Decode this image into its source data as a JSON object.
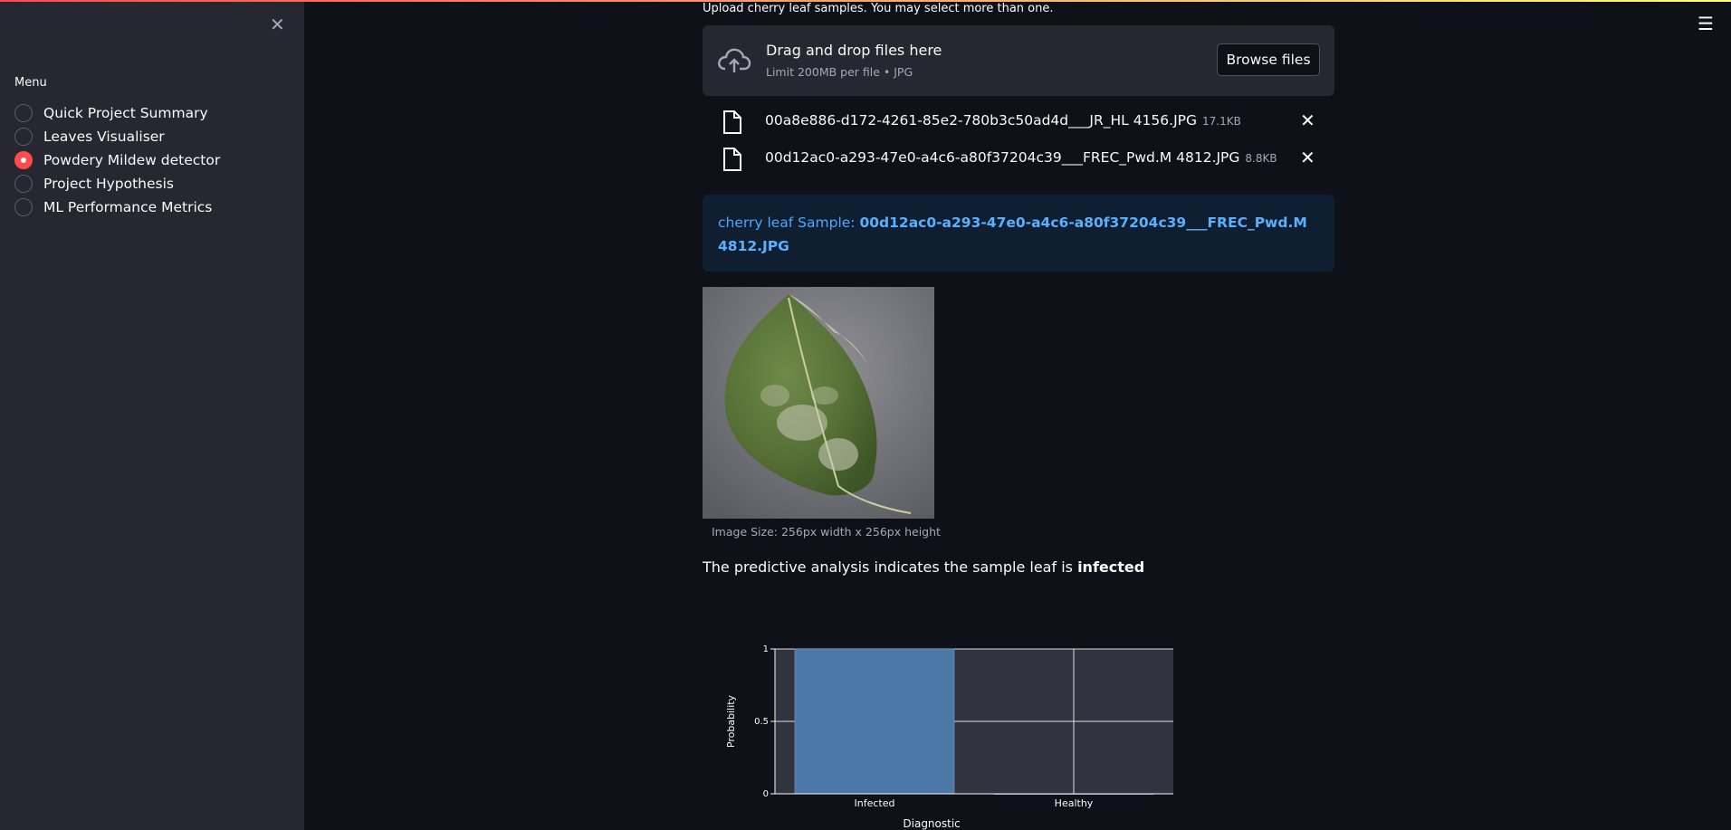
{
  "sidebar": {
    "menu_label": "Menu",
    "items": [
      {
        "label": "Quick Project Summary",
        "checked": false
      },
      {
        "label": "Leaves Visualiser",
        "checked": false
      },
      {
        "label": "Powdery Mildew detector",
        "checked": true
      },
      {
        "label": "Project Hypothesis",
        "checked": false
      },
      {
        "label": "ML Performance Metrics",
        "checked": false
      }
    ]
  },
  "uploader": {
    "label": "Upload cherry leaf samples. You may select more than one.",
    "drop_title": "Drag and drop files here",
    "drop_subtitle": "Limit 200MB per file • JPG",
    "browse_label": "Browse files",
    "files": [
      {
        "name": "00a8e886-d172-4261-85e2-780b3c50ad4d___JR_HL 4156.JPG",
        "size": "17.1KB"
      },
      {
        "name": "00d12ac0-a293-47e0-a4c6-a80f37204c39___FREC_Pwd.M 4812.JPG",
        "size": "8.8KB"
      }
    ]
  },
  "result": {
    "sample_prefix": "cherry leaf Sample: ",
    "sample_name": "00d12ac0-a293-47e0-a4c6-a80f37204c39___FREC_Pwd.M 4812.JPG",
    "image_caption": "Image Size: 256px width x 256px height",
    "prediction_prefix": "The predictive analysis indicates the sample leaf is ",
    "prediction_value": "infected"
  },
  "colors": {
    "accent": "#ff4b4b",
    "info_text": "#4aa8ff",
    "bar": "#4c78a8",
    "plot_bg": "#31333f"
  },
  "chart_data": {
    "type": "bar",
    "categories": [
      "Infected",
      "Healthy"
    ],
    "values": [
      1,
      0
    ],
    "xlabel": "Diagnostic",
    "ylabel": "Probability",
    "ylim": [
      0,
      1
    ],
    "yticks": [
      "0",
      "0.5",
      "1"
    ],
    "grid": true
  }
}
